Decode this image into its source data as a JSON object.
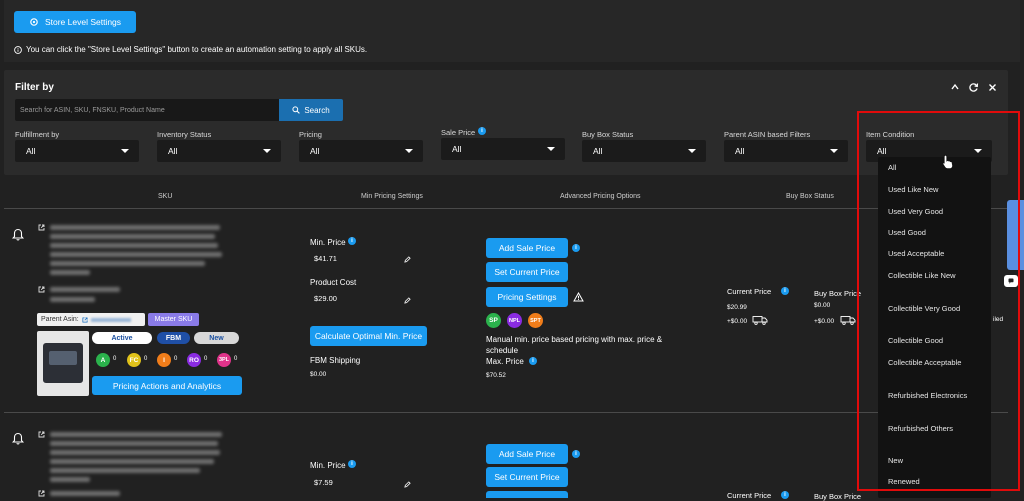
{
  "store_settings_button": "Store Level Settings",
  "info_notice": "You can click the \"Store Level Settings\" button to create an automation setting to apply all SKUs.",
  "filter": {
    "title": "Filter by",
    "search_placeholder": "Search for ASIN, SKU, FNSKU, Product Name",
    "search_button": "Search",
    "fields": [
      {
        "label": "Fulfillment by",
        "value": "All"
      },
      {
        "label": "Inventory Status",
        "value": "All"
      },
      {
        "label": "Pricing",
        "value": "All"
      },
      {
        "label": "Sale Price",
        "value": "All"
      },
      {
        "label": "Buy Box Status",
        "value": "All"
      },
      {
        "label": "Parent ASIN based Filters",
        "value": "All"
      },
      {
        "label": "Item Condition",
        "value": "All"
      }
    ]
  },
  "columns": [
    "SKU",
    "Min Pricing Settings",
    "Advanced Pricing Options",
    "Buy Box Status"
  ],
  "row1": {
    "parent_asin_label": "Parent Asin:",
    "master_sku": "Master SKU",
    "status_active": "Active",
    "status_fbm": "FBM",
    "status_new": "New",
    "badges": [
      {
        "code": "A",
        "count": "0",
        "color": "#2bb24c"
      },
      {
        "code": "FC",
        "count": "0",
        "color": "#e0c21a"
      },
      {
        "code": "I",
        "count": "0",
        "color": "#f07d1a"
      },
      {
        "code": "RO",
        "count": "0",
        "color": "#8a2be2"
      },
      {
        "code": "3PL",
        "count": "0",
        "color": "#e0338a"
      }
    ],
    "pricing_actions": "Pricing Actions and Analytics",
    "min_price_label": "Min. Price",
    "min_price_value": "$41.71",
    "product_cost_label": "Product Cost",
    "product_cost_value": "$29.00",
    "calc_button": "Calculate Optimal Min. Price",
    "fbm_shipping_label": "FBM Shipping",
    "fbm_shipping_value": "$0.00",
    "add_sale_price": "Add Sale Price",
    "set_current_price": "Set Current Price",
    "pricing_settings": "Pricing Settings",
    "adv_badges": [
      {
        "code": "SP",
        "color": "#2bb24c"
      },
      {
        "code": "NPL",
        "color": "#8a2be2"
      },
      {
        "code": "SPT",
        "color": "#f07d1a"
      }
    ],
    "strategy_text": "Manual min. price based pricing with max. price & schedule",
    "max_price_label": "Max. Price",
    "max_price_value": "$70.52",
    "current_price_label": "Current Price",
    "current_price_value": "$20.99",
    "current_shipping": "+$0.00",
    "buy_box_price_label": "Buy Box Price",
    "buy_box_price_value": "$0.00",
    "buy_box_shipping": "+$0.00",
    "status_cut": "iled"
  },
  "row2": {
    "min_price_label": "Min. Price",
    "min_price_value": "$7.59",
    "add_sale_price": "Add Sale Price",
    "set_current_price": "Set Current Price",
    "current_price_label": "Current Price",
    "buy_box_price_label": "Buy Box Price"
  },
  "item_condition_options": [
    "All",
    "Used Like New",
    "Used Very Good",
    "Used Good",
    "Used Acceptable",
    "Collectible Like New",
    "Collectible Very Good",
    "Collectible Good",
    "Collectible Acceptable",
    "Refurbished Electronics",
    "Refurbished Others",
    "New",
    "Renewed"
  ]
}
